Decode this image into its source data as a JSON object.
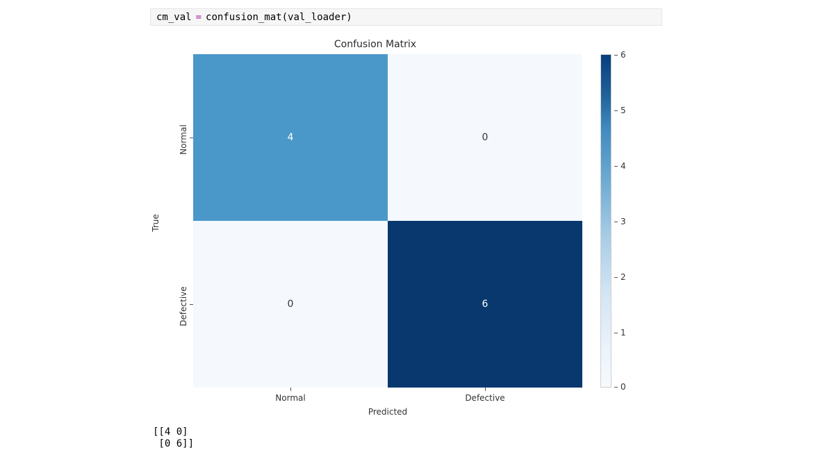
{
  "code": {
    "var": "cm_val",
    "op": "=",
    "call": "confusion_mat(val_loader)"
  },
  "chart_data": {
    "type": "heatmap",
    "title": "Confusion Matrix",
    "xlabel": "Predicted",
    "ylabel": "True",
    "x_categories": [
      "Normal",
      "Defective"
    ],
    "y_categories": [
      "Normal",
      "Defective"
    ],
    "values": [
      [
        4,
        0
      ],
      [
        0,
        6
      ]
    ],
    "vmin": 0,
    "vmax": 6,
    "colormap": "Blues",
    "colorbar_ticks": [
      0,
      1,
      2,
      3,
      4,
      5,
      6
    ],
    "cell_colors": [
      [
        "#4a98ca",
        "#f5f9fd"
      ],
      [
        "#f5f9fd",
        "#09386f"
      ]
    ],
    "cell_text_colors": [
      [
        "light",
        "dark"
      ],
      [
        "dark",
        "light"
      ]
    ]
  },
  "output_text": "[[4 0]\n [0 6]]"
}
